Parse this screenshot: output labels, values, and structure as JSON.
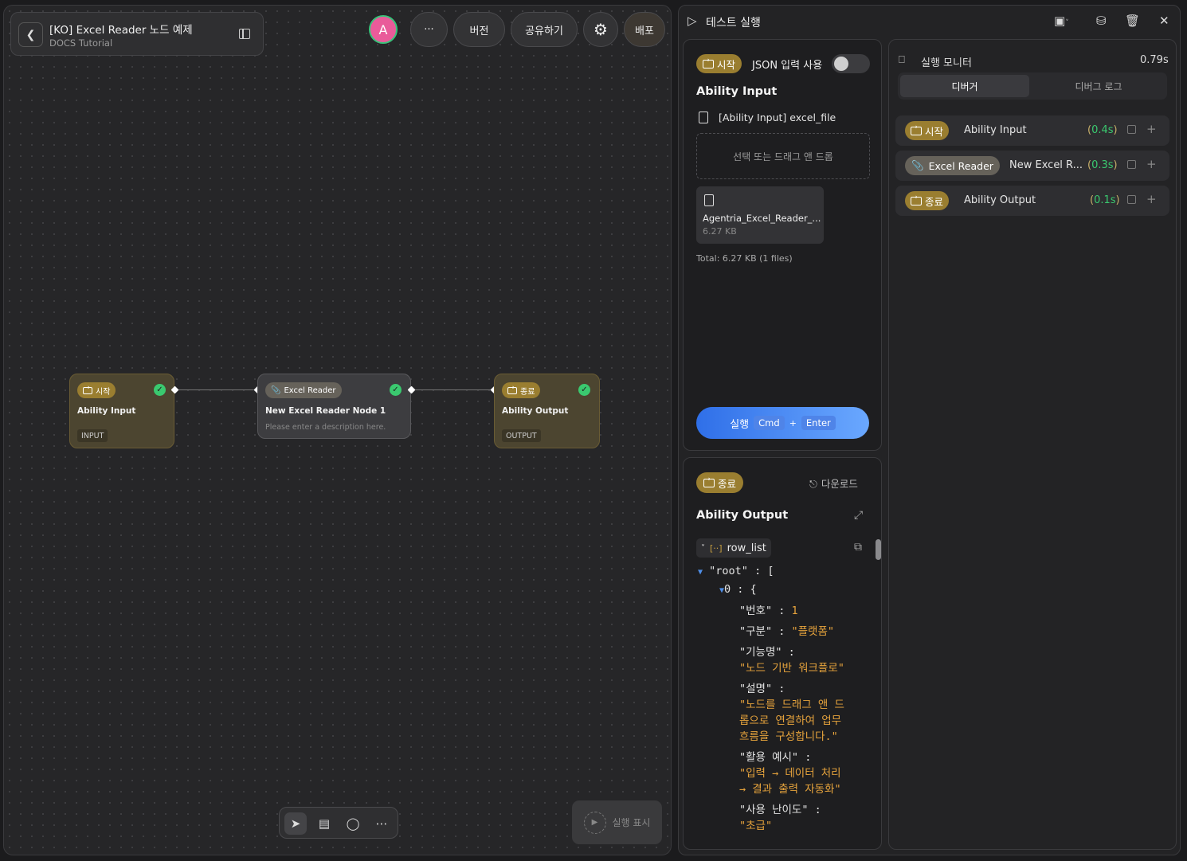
{
  "header": {
    "title": "[KO] Excel Reader 노드 예제",
    "subtitle": "DOCS Tutorial",
    "avatar_letter": "A",
    "more_label": "···",
    "version_label": "버전",
    "share_label": "공유하기",
    "deploy_label": "배포"
  },
  "nodes": {
    "start": {
      "badge": "시작",
      "title": "Ability Input",
      "tag": "INPUT"
    },
    "excel": {
      "badge": "Excel Reader",
      "title": "New Excel Reader Node 1",
      "desc": "Please enter a description here."
    },
    "end": {
      "badge": "종료",
      "title": "Ability Output",
      "tag": "OUTPUT"
    }
  },
  "canvas": {
    "run_show_label": "실행 표시"
  },
  "test_panel": {
    "title": "테스트 실행",
    "input": {
      "badge": "시작",
      "json_toggle_label": "JSON 입력 사용",
      "section_title": "Ability Input",
      "field_label": "[Ability Input] excel_file",
      "dropzone_text": "선택 또는 드래그 앤 드롭",
      "file_name": "Agentria_Excel_Reader_...",
      "file_size": "6.27 KB",
      "total": "Total: 6.27 KB (1 files)",
      "run_label": "실행",
      "kbd_cmd": "Cmd",
      "kbd_plus": "+",
      "kbd_enter": "Enter"
    },
    "output": {
      "badge": "종료",
      "download_label": "다운로드",
      "section_title": "Ability Output",
      "field_name": "row_list",
      "json_lines": {
        "root": "\"root\" : [",
        "idx": "0 : {",
        "k1": "\"번호\" : ",
        "v1": "1",
        "k2": "\"구분\" : ",
        "v2": "\"플랫폼\"",
        "k3": "\"기능명\" :",
        "v3": "\"노드 기반 워크플로\"",
        "k4": "\"설명\" :",
        "v4a": "\"노드를 드래그 앤 드",
        "v4b": "롭으로 연결하여 업무",
        "v4c": "흐름을 구성합니다.\"",
        "k5": "\"활용 예시\" :",
        "v5a": "\"입력 → 데이터 처리",
        "v5b": "→ 결과 출력 자동화\"",
        "k6": "\"사용 난이도\" :",
        "v6": "\"초급\""
      }
    },
    "monitor": {
      "title": "실행 모니터",
      "total_time": "0.79s",
      "tabs": [
        "디버거",
        "디버그 로그"
      ],
      "rows": [
        {
          "badge": "시작",
          "name": "Ability Input",
          "time": "0.4s"
        },
        {
          "badge": "Excel Reader",
          "name": "New Excel R...",
          "time": "0.3s"
        },
        {
          "badge": "종료",
          "name": "Ability Output",
          "time": "0.1s"
        }
      ]
    }
  }
}
